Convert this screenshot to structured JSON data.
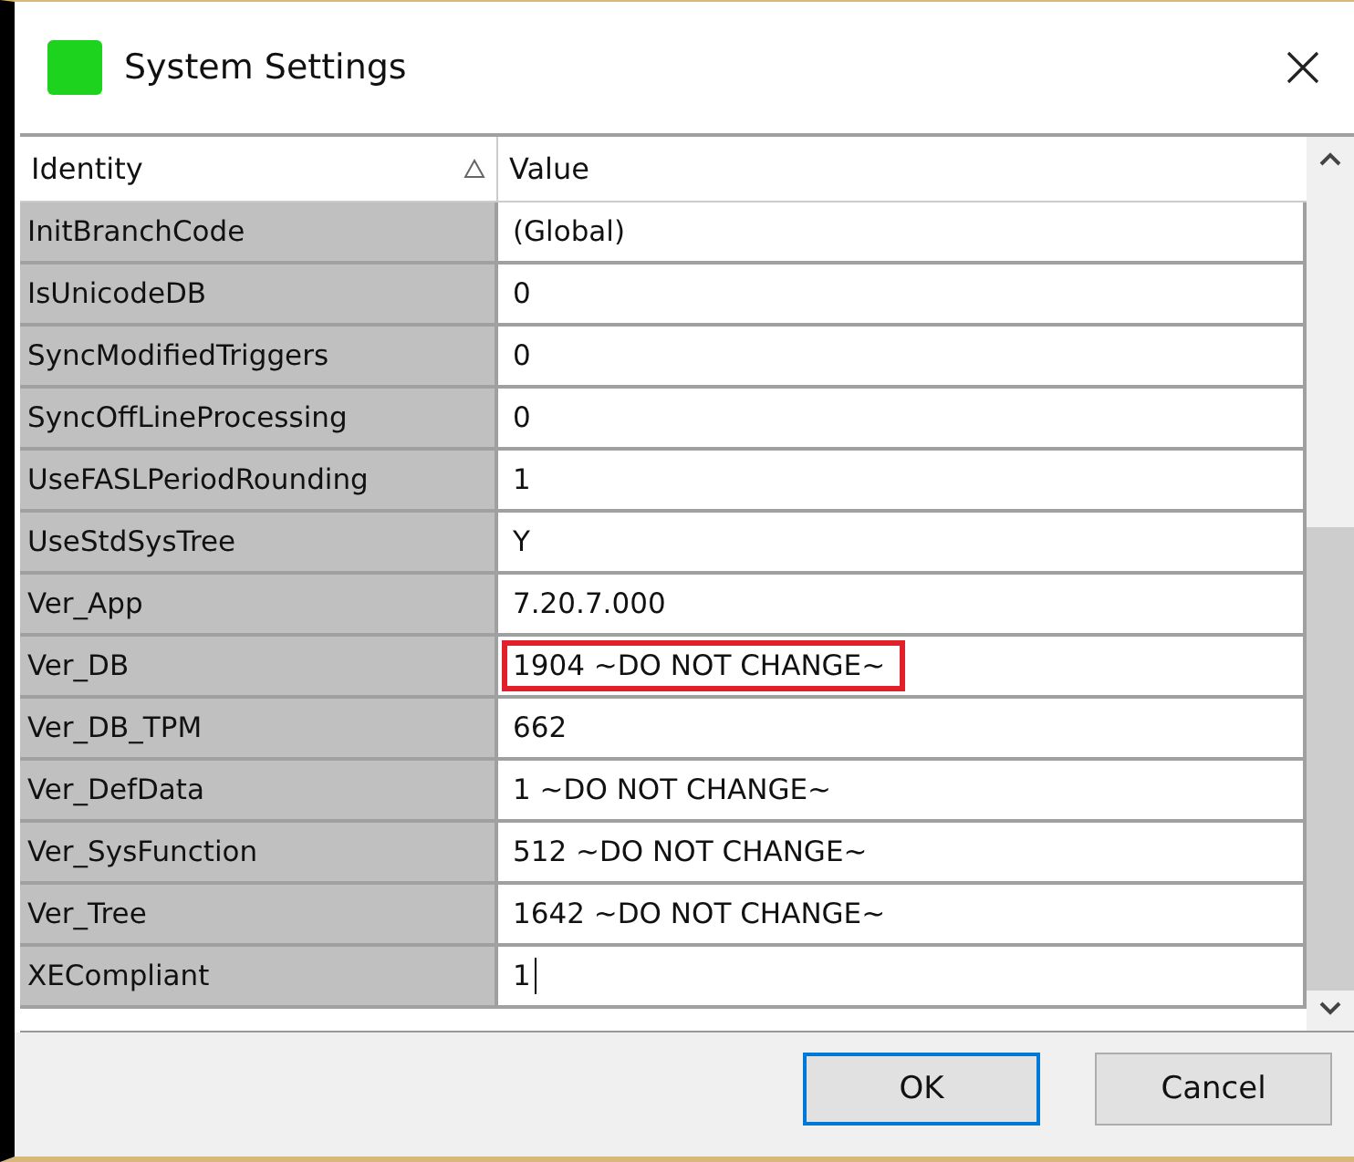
{
  "window": {
    "title": "System Settings"
  },
  "grid": {
    "columns": [
      {
        "label": "Identity",
        "sorted_ascending": true
      },
      {
        "label": "Value",
        "sorted_ascending": false
      }
    ],
    "rows": [
      {
        "identity": "InitBranchCode",
        "value": "(Global)",
        "highlighted": false,
        "editing": false
      },
      {
        "identity": "IsUnicodeDB",
        "value": "0",
        "highlighted": false,
        "editing": false
      },
      {
        "identity": "SyncModifiedTriggers",
        "value": "0",
        "highlighted": false,
        "editing": false
      },
      {
        "identity": "SyncOffLineProcessing",
        "value": "0",
        "highlighted": false,
        "editing": false
      },
      {
        "identity": "UseFASLPeriodRounding",
        "value": "1",
        "highlighted": false,
        "editing": false
      },
      {
        "identity": "UseStdSysTree",
        "value": "Y",
        "highlighted": false,
        "editing": false
      },
      {
        "identity": "Ver_App",
        "value": "7.20.7.000",
        "highlighted": false,
        "editing": false
      },
      {
        "identity": "Ver_DB",
        "value": "1904 ~DO NOT CHANGE~",
        "highlighted": true,
        "editing": false
      },
      {
        "identity": "Ver_DB_TPM",
        "value": "662",
        "highlighted": false,
        "editing": false
      },
      {
        "identity": "Ver_DefData",
        "value": "1 ~DO NOT CHANGE~",
        "highlighted": false,
        "editing": false
      },
      {
        "identity": "Ver_SysFunction",
        "value": "512 ~DO NOT CHANGE~",
        "highlighted": false,
        "editing": false
      },
      {
        "identity": "Ver_Tree",
        "value": "1642 ~DO NOT CHANGE~",
        "highlighted": false,
        "editing": false
      },
      {
        "identity": "XECompliant",
        "value": "1",
        "highlighted": false,
        "editing": true
      }
    ]
  },
  "buttons": [
    {
      "label": "OK",
      "default": true
    },
    {
      "label": "Cancel",
      "default": false
    }
  ]
}
